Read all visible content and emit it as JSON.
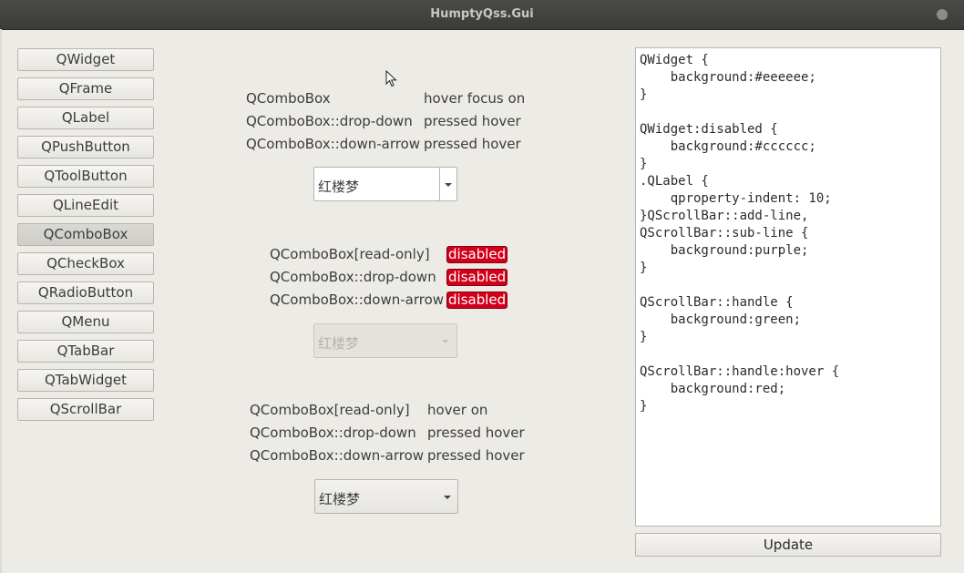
{
  "window": {
    "title": "HumptyQss.Gui"
  },
  "nav": {
    "items": [
      {
        "label": "QWidget"
      },
      {
        "label": "QFrame"
      },
      {
        "label": "QLabel"
      },
      {
        "label": "QPushButton"
      },
      {
        "label": "QToolButton"
      },
      {
        "label": "QLineEdit"
      },
      {
        "label": "QComboBox",
        "active": true
      },
      {
        "label": "QCheckBox"
      },
      {
        "label": "QRadioButton"
      },
      {
        "label": "QMenu"
      },
      {
        "label": "QTabBar"
      },
      {
        "label": "QTabWidget"
      },
      {
        "label": "QScrollBar"
      }
    ]
  },
  "section1": {
    "rows": [
      {
        "name": "QComboBox",
        "state": "hover  focus  on"
      },
      {
        "name": "QComboBox::drop-down",
        "state": "pressed  hover"
      },
      {
        "name": "QComboBox::down-arrow",
        "state": "pressed  hover"
      }
    ],
    "combo_value": "红楼梦"
  },
  "section2": {
    "rows": [
      {
        "name": "QComboBox[read-only]",
        "state": "disabled"
      },
      {
        "name": "QComboBox::drop-down",
        "state": "disabled"
      },
      {
        "name": "QComboBox::down-arrow",
        "state": "disabled"
      }
    ],
    "combo_value": "红楼梦"
  },
  "section3": {
    "rows": [
      {
        "name": "QComboBox[read-only]",
        "state": "hover  on"
      },
      {
        "name": "QComboBox::drop-down",
        "state": "pressed  hover"
      },
      {
        "name": "QComboBox::down-arrow",
        "state": "pressed  hover"
      }
    ],
    "combo_value": "红楼梦"
  },
  "editor": {
    "text": "QWidget {\n    background:#eeeeee;\n}\n\nQWidget:disabled {\n    background:#cccccc;\n}\n.QLabel {\n    qproperty-indent: 10;\n}QScrollBar::add-line,\nQScrollBar::sub-line {\n    background:purple;\n}\n\nQScrollBar::handle {\n    background:green;\n}\n\nQScrollBar::handle:hover {\n    background:red;\n}"
  },
  "update_button": {
    "label": "Update"
  },
  "colors": {
    "disabled_badge": "#d0001b",
    "window_bg": "#ecebe6",
    "titlebar": "#3b3b38"
  }
}
